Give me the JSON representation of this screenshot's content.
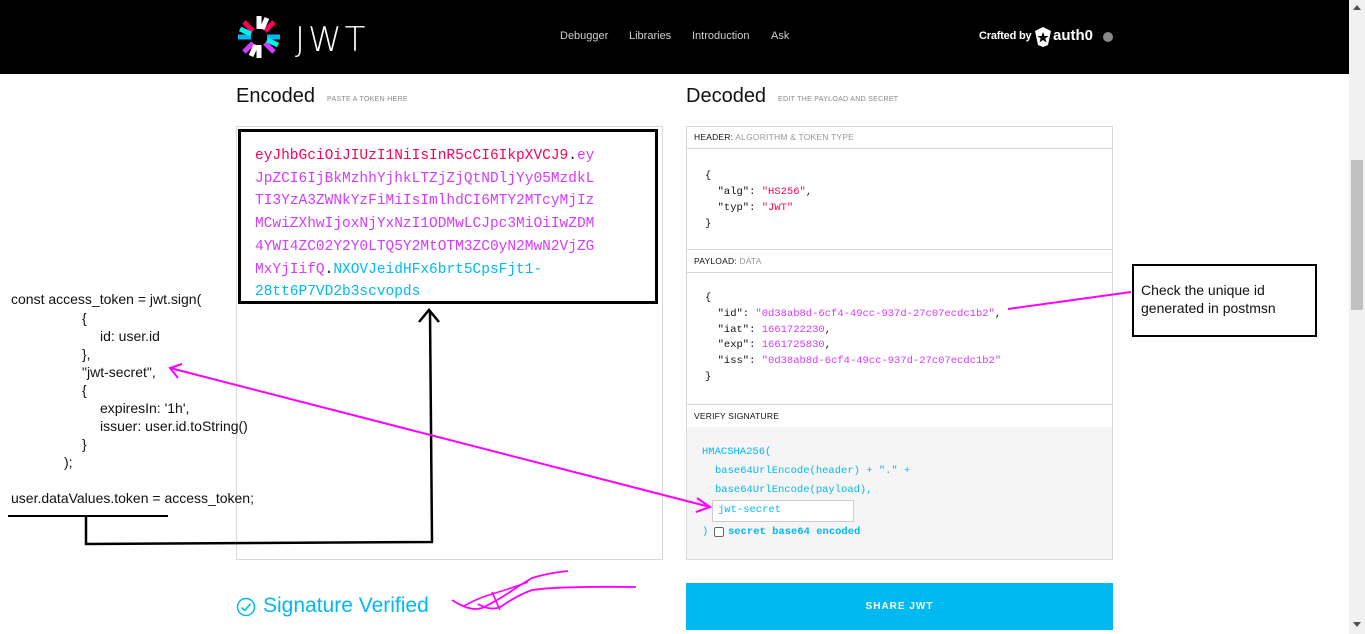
{
  "header": {
    "logo_text": "JWT",
    "nav": [
      {
        "label": "Debugger"
      },
      {
        "label": "Libraries"
      },
      {
        "label": "Introduction"
      },
      {
        "label": "Ask"
      }
    ],
    "crafted_by": "Crafted by",
    "brand": "auth0"
  },
  "encoded": {
    "title": "Encoded",
    "subtitle": "PASTE A TOKEN HERE",
    "token_lines": [
      {
        "header": "eyJhbGciOiJIUzI1NiIsInR5cCI6IkpXVCJ9",
        "dot": ".",
        "payload": "ey"
      },
      {
        "payload": "JpZCI6IjBkMzhhYjhkLTZjZjQtNDljYy05MzdkL"
      },
      {
        "payload": "TI3YzA3ZWNkYzFiMiIsImlhdCI6MTY2MTcyMjIz"
      },
      {
        "payload": "MCwiZXhwIjoxNjYxNzI1ODMwLCJpc3MiOiIwZDM"
      },
      {
        "payload": "4YWI4ZC02Y2Y0LTQ5Y2MtOTM3ZC0yN2MwN2VjZG"
      },
      {
        "payload": "MxYjIifQ",
        "dot": ".",
        "signature": "NXOVJeidHFx6brt5CpsFjt1-"
      },
      {
        "signature": "28tt6P7VD2b3scvopds"
      }
    ]
  },
  "decoded": {
    "title": "Decoded",
    "subtitle": "EDIT THE PAYLOAD AND SECRET",
    "header_section": {
      "label": "HEADER:",
      "sublabel": "ALGORITHM & TOKEN TYPE"
    },
    "header_json": {
      "alg": "\"HS256\"",
      "typ": "\"JWT\""
    },
    "payload_section": {
      "label": "PAYLOAD:",
      "sublabel": "DATA"
    },
    "payload_json": {
      "id": "\"0d38ab8d-6cf4-49cc-937d-27c07ecdc1b2\"",
      "iat": "1661722230",
      "exp": "1661725830",
      "iss": "\"0d38ab8d-6cf4-49cc-937d-27c07ecdc1b2\""
    },
    "verify_section": {
      "label": "VERIFY SIGNATURE"
    },
    "verify": {
      "fn": "HMACSHA256(",
      "line1": "base64UrlEncode(header) + \".\" +",
      "line2": "base64UrlEncode(payload),",
      "secret_value": "jwt-secret",
      "close": ")",
      "checkbox_label": "secret base64 encoded"
    }
  },
  "signature_verified": "Signature Verified",
  "share_button": "SHARE JWT",
  "annotations": {
    "code_lines": [
      "const access_token = jwt.sign(",
      "{",
      "id: user.id",
      "},",
      "\"jwt-secret\",",
      "{",
      "expiresIn: '1h',",
      "issuer: user.id.toString()",
      "}",
      ");"
    ],
    "assignment": "user.dataValues.token = access_token;",
    "note": "Check the unique id generated in postmsn"
  },
  "colors": {
    "header": "#fb015b",
    "payload": "#d63aff",
    "signature": "#00b9f1",
    "annotation": "#ff00ff"
  }
}
